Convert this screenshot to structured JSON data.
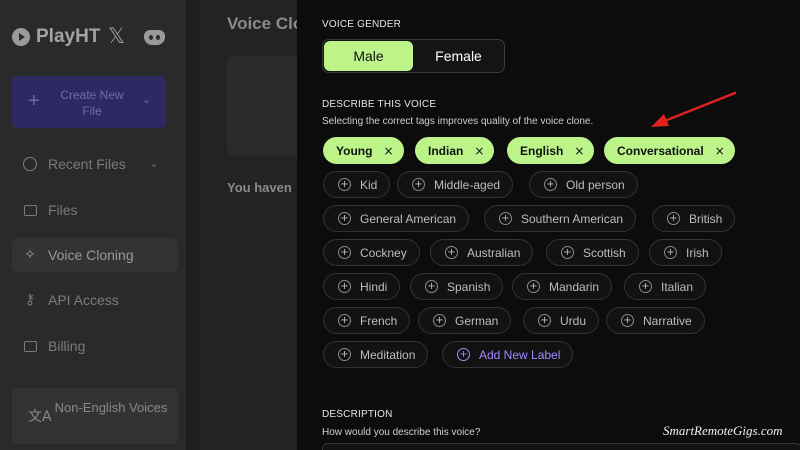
{
  "sidebar": {
    "brand": "PlayHT",
    "create_button": {
      "label": "Create New File"
    },
    "items": [
      {
        "label": "Recent Files"
      },
      {
        "label": "Files"
      },
      {
        "label": "Voice Cloning"
      },
      {
        "label": "API Access"
      },
      {
        "label": "Billing"
      }
    ],
    "language_button": {
      "label": "Non-English Voices"
    }
  },
  "main": {
    "title": "Voice Clon",
    "empty_text": "You haven"
  },
  "panel": {
    "gender": {
      "label": "VOICE GENDER",
      "options": [
        "Male",
        "Female"
      ],
      "selected": "Male"
    },
    "describe": {
      "label": "DESCRIBE THIS VOICE",
      "helper": "Selecting the correct tags improves quality of the voice clone.",
      "selected_tags": [
        "Young",
        "Indian",
        "English",
        "Conversational"
      ],
      "available_tags": [
        "Kid",
        "Middle-aged",
        "Old person",
        "General American",
        "Southern American",
        "British",
        "Cockney",
        "Australian",
        "Scottish",
        "Irish",
        "Hindi",
        "Spanish",
        "Mandarin",
        "Italian",
        "French",
        "German",
        "Urdu",
        "Narrative",
        "Meditation"
      ],
      "add_label": "Add New Label"
    },
    "description": {
      "label": "DESCRIPTION",
      "helper": "How would you describe this voice?"
    }
  },
  "watermark": "SmartRemoteGigs.com",
  "colors": {
    "accent_green": "#bdf48a",
    "accent_purple": "#a48aff",
    "arrow_red": "#e0211f"
  },
  "icons": {
    "close": "×",
    "add": "+"
  }
}
